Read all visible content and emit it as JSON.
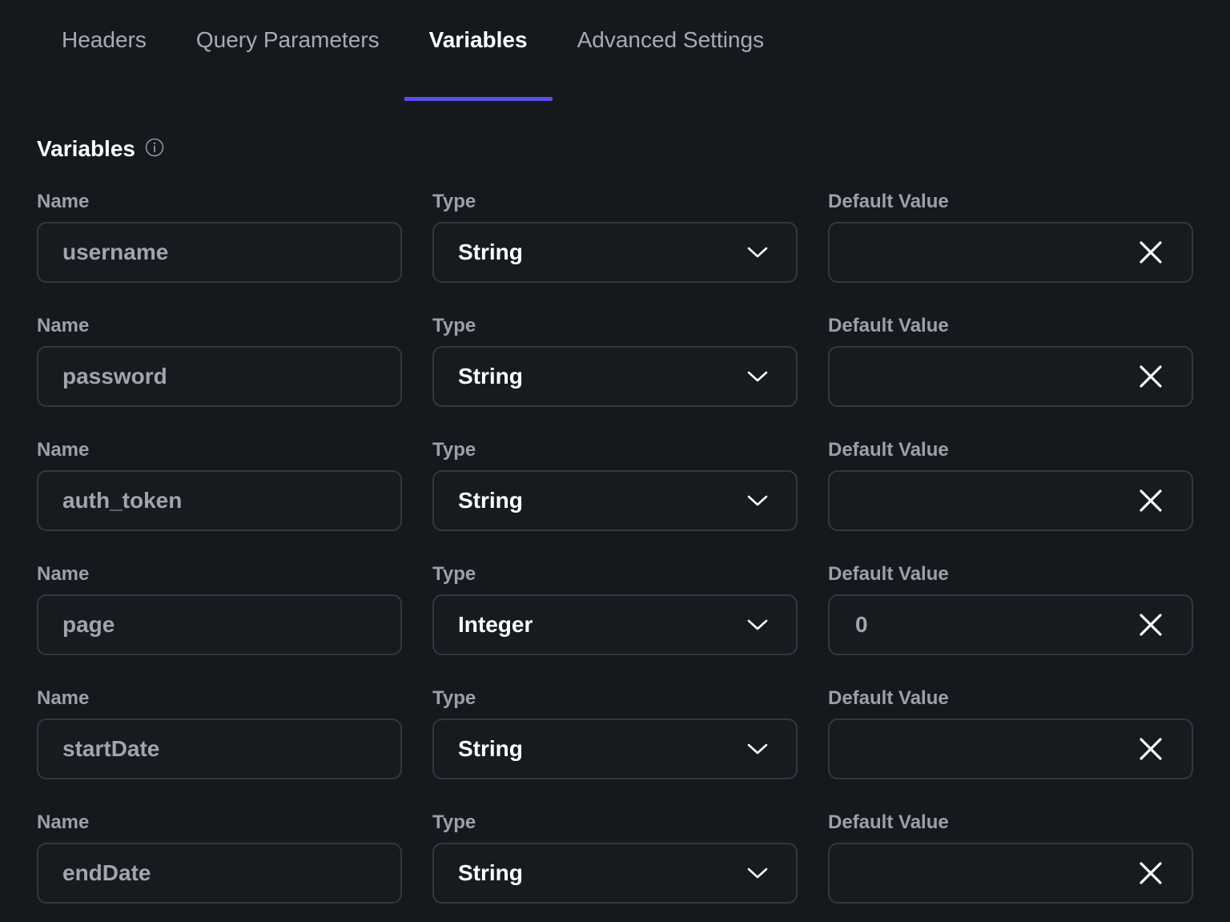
{
  "tabs": [
    {
      "label": "Headers",
      "active": false
    },
    {
      "label": "Query Parameters",
      "active": false
    },
    {
      "label": "Variables",
      "active": true
    },
    {
      "label": "Advanced Settings",
      "active": false
    }
  ],
  "section": {
    "title": "Variables",
    "info_icon": "info-icon"
  },
  "labels": {
    "name": "Name",
    "type": "Type",
    "default_value": "Default Value"
  },
  "variables": [
    {
      "name": "username",
      "type": "String",
      "default": ""
    },
    {
      "name": "password",
      "type": "String",
      "default": ""
    },
    {
      "name": "auth_token",
      "type": "String",
      "default": ""
    },
    {
      "name": "page",
      "type": "Integer",
      "default": "0"
    },
    {
      "name": "startDate",
      "type": "String",
      "default": ""
    },
    {
      "name": "endDate",
      "type": "String",
      "default": ""
    }
  ],
  "colors": {
    "background": "#15191e",
    "accent": "#5b4ff0",
    "border": "#33383f"
  }
}
